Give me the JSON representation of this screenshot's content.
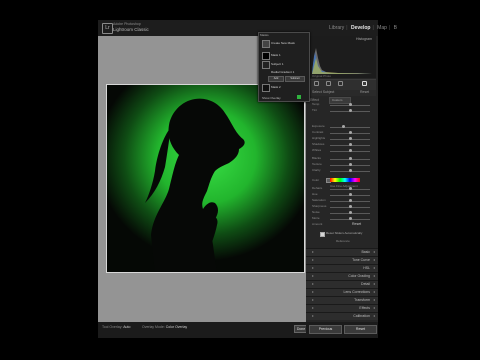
{
  "app": {
    "brand_line1": "Adobe Photoshop",
    "brand_line2": "Lightroom Classic",
    "modules": [
      "Library",
      "Develop",
      "Map",
      "B"
    ],
    "active_module": "Develop"
  },
  "histogram": {
    "title": "Histogram",
    "meta": "Original Photo"
  },
  "mask_bar": {
    "left": "Select Subject",
    "right": "Reset"
  },
  "preset": {
    "label": "Effect",
    "value": "Custom"
  },
  "sliders": [
    {
      "label": "Temp",
      "pos": 0.5
    },
    {
      "label": "Tint",
      "pos": 0.5
    },
    {
      "label": "Exposure",
      "pos": 0.34
    },
    {
      "label": "Contrast",
      "pos": 0.5
    },
    {
      "label": "Highlights",
      "pos": 0.5
    },
    {
      "label": "Shadows",
      "pos": 0.5
    },
    {
      "label": "Whites",
      "pos": 0.5
    },
    {
      "label": "Blacks",
      "pos": 0.5
    },
    {
      "label": "Texture",
      "pos": 0.5
    },
    {
      "label": "Clarity",
      "pos": 0.5
    },
    {
      "label": "Dehaze",
      "pos": 0.5
    },
    {
      "label": "Hue",
      "pos": 0.5
    },
    {
      "label": "Saturation",
      "pos": 0.5
    },
    {
      "label": "Sharpness",
      "pos": 0.5
    },
    {
      "label": "Noise",
      "pos": 0.5
    },
    {
      "label": "Moire",
      "pos": 0.5
    },
    {
      "label": "Defringe",
      "pos": 0.5
    }
  ],
  "color_label": "Color",
  "fine_tune": "Use Fine Adjustment",
  "amount_hint": "Amount",
  "hot_label": "Reset",
  "mask_checkbox": "Reset Sliders Automatically",
  "sections": [
    "Basic",
    "Tone Curve",
    "HSL",
    "Color Grading",
    "Detail",
    "Lens Corrections",
    "Transform",
    "Effects",
    "Calibration"
  ],
  "top_section": "Reference",
  "mask_panel": {
    "header": "Masks",
    "items": [
      {
        "name": "Create New Mask"
      },
      {
        "name": "Mask 1"
      },
      {
        "name": "Subject 1"
      },
      {
        "name": "Radial Gradient 1"
      },
      {
        "name": "Mask 2"
      }
    ],
    "add_label": "Add",
    "subtract_label": "Subtract",
    "show_overlay": "Show Overlay"
  },
  "filmstrip": {
    "items": [
      {
        "k": "Tool Overlay:",
        "v": "Auto"
      },
      {
        "k": "Overlay Mode:",
        "v": "Color Overlay"
      }
    ],
    "done_label": "Done"
  },
  "buttons": {
    "previous": "Previous",
    "reset": "Reset"
  },
  "colors": {
    "glow": "#2ed63a",
    "canvas": "#949494",
    "panel": "#262626"
  }
}
